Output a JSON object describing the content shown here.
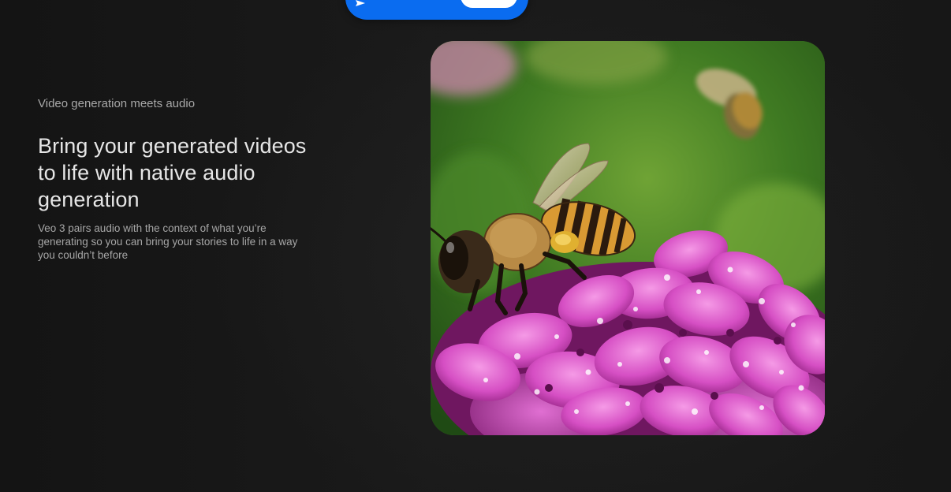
{
  "section": {
    "eyebrow": "Video generation meets audio",
    "headline": "Bring your generated videos to life with native audio generation",
    "description": "Veo 3 pairs audio with the context of what you’re generating so you can bring your stories to life in a way you couldn’t before"
  },
  "media": {
    "image": "bee-on-pink-flower-video",
    "icon": "video-thumbnail"
  },
  "top_bar": {
    "icon": "send-icon"
  },
  "colors": {
    "background": "#131313",
    "accent": "#0a6cf0",
    "headline": "#e6e6e6",
    "muted_text": "#a8a8a8"
  }
}
